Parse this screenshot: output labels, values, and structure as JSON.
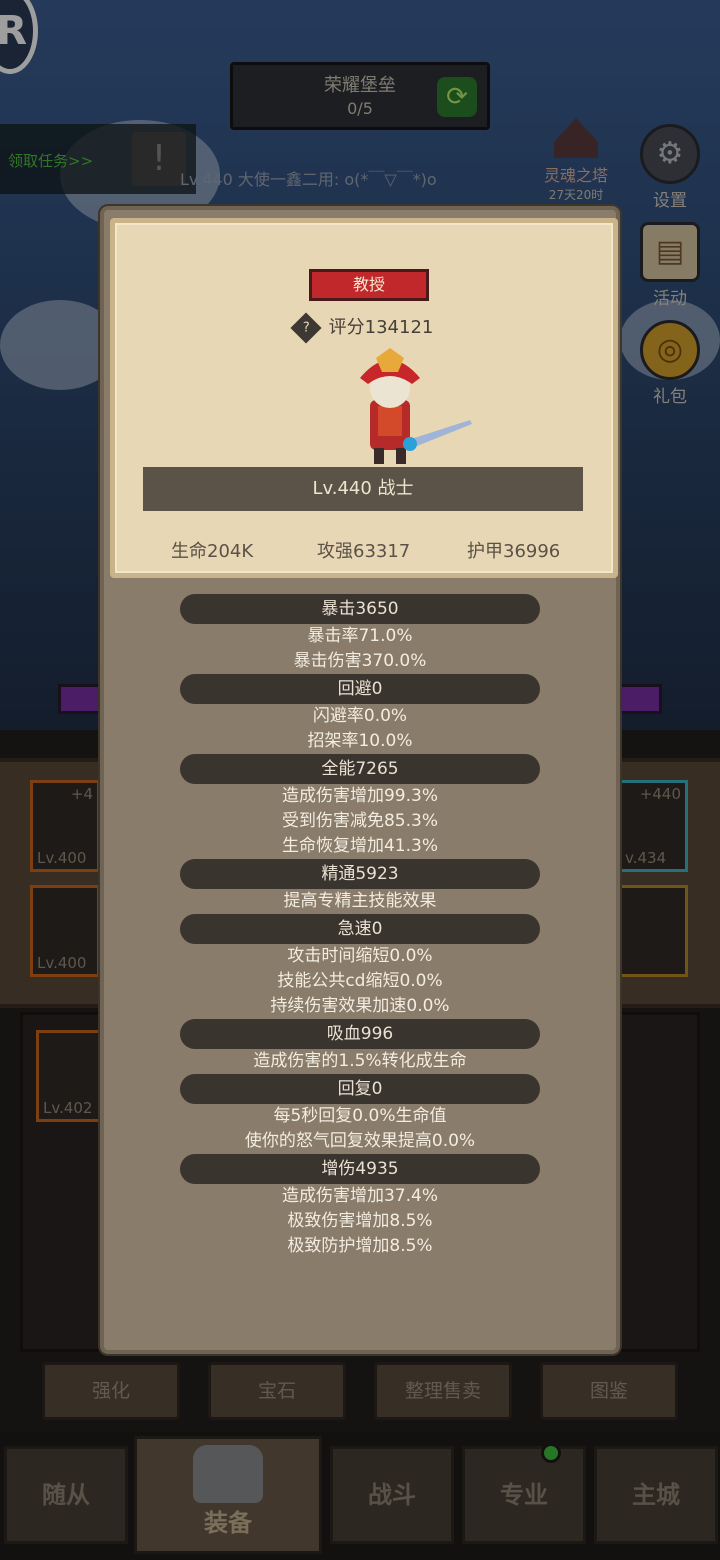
{
  "background": {
    "logo_letter": "R",
    "fortress": {
      "title": "荣耀堡垒",
      "count": "0/5",
      "refresh_icon": "refresh-icon"
    },
    "quest_bar": {
      "label": "领取任务>>",
      "icon": "exclamation-icon"
    },
    "chat_line": "Lv.440 大使一鑫二用: o(*￣▽￣*)o",
    "tower": {
      "label": "灵魂之塔",
      "time": "27天20时"
    },
    "side_buttons": [
      {
        "label": "设置",
        "icon": "gear-icon",
        "glyph": "⚙"
      },
      {
        "label": "活动",
        "icon": "book-icon",
        "glyph": "▤"
      },
      {
        "label": "礼包",
        "icon": "gift-icon",
        "glyph": "◎"
      }
    ],
    "slots": [
      {
        "lv": "Lv.400",
        "plus": "+4"
      },
      {
        "lv": "Lv.400",
        "plus": ""
      },
      {
        "lv": "Lv.402",
        "plus": ""
      },
      {
        "lv": "v.434",
        "plus": "+440"
      }
    ],
    "actions": [
      "强化",
      "宝石",
      "整理售卖",
      "图鉴"
    ],
    "nav": [
      "随从",
      "装备",
      "战斗",
      "专业",
      "主城"
    ]
  },
  "popup": {
    "title": "教授",
    "score_label": "评分134121",
    "help_icon": "question-icon",
    "level_class": "Lv.440 战士",
    "stats": {
      "hp": "生命204K",
      "atk": "攻强63317",
      "armor": "护甲36996"
    },
    "groups": [
      {
        "head": "暴击3650",
        "lines": [
          "暴击率71.0%",
          "暴击伤害370.0%"
        ]
      },
      {
        "head": "回避0",
        "lines": [
          "闪避率0.0%",
          "招架率10.0%"
        ]
      },
      {
        "head": "全能7265",
        "lines": [
          "造成伤害增加99.3%",
          "受到伤害减免85.3%",
          "生命恢复增加41.3%"
        ]
      },
      {
        "head": "精通5923",
        "lines": [
          "提高专精主技能效果"
        ]
      },
      {
        "head": "急速0",
        "lines": [
          "攻击时间缩短0.0%",
          "技能公共cd缩短0.0%",
          "持续伤害效果加速0.0%"
        ]
      },
      {
        "head": "吸血996",
        "lines": [
          "造成伤害的1.5%转化成生命"
        ]
      },
      {
        "head": "回复0",
        "lines": [
          "每5秒回复0.0%生命值",
          "使你的怒气回复效果提高0.0%"
        ]
      },
      {
        "head": "增伤4935",
        "lines": [
          "造成伤害增加37.4%",
          "极致伤害增加8.5%",
          "极致防护增加8.5%"
        ]
      }
    ]
  }
}
